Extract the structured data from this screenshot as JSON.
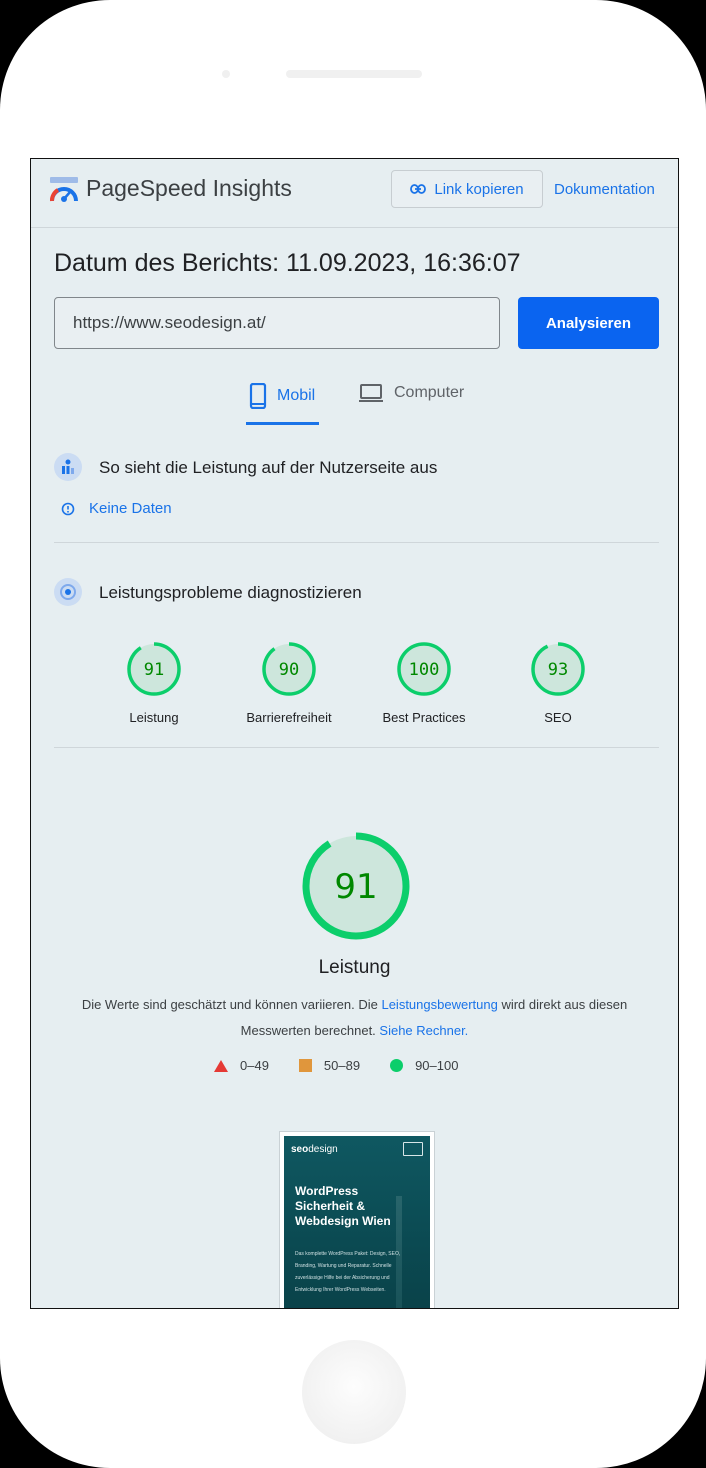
{
  "app": {
    "title": "PageSpeed Insights",
    "copy_link_label": "Link kopieren",
    "docs_label": "Dokumentation"
  },
  "report": {
    "date_label": "Datum des Berichts: 11.09.2023, 16:36:07",
    "url_value": "https://www.seodesign.at/",
    "analyze_label": "Analysieren"
  },
  "tabs": [
    {
      "label": "Mobil",
      "active": true,
      "icon": "phone-icon"
    },
    {
      "label": "Computer",
      "active": false,
      "icon": "laptop-icon"
    }
  ],
  "field_section": {
    "title": "So sieht die Leistung auf der Nutzerseite aus",
    "no_data_label": "Keine Daten"
  },
  "lab_section": {
    "title": "Leistungsprobleme diagnostizieren",
    "scores": [
      {
        "value": 91,
        "label": "Leistung"
      },
      {
        "value": 90,
        "label": "Barrierefreiheit"
      },
      {
        "value": 100,
        "label": "Best Practices"
      },
      {
        "value": 93,
        "label": "SEO"
      }
    ]
  },
  "performance": {
    "score": 91,
    "label": "Leistung",
    "desc_part1": "Die Werte sind geschätzt und können variieren. Die ",
    "desc_link1": "Leistungsbewertung",
    "desc_part2": " wird direkt aus diesen Messwerten berechnet. ",
    "desc_link2": "Siehe Rechner.",
    "legend": [
      {
        "range": "0–49",
        "shape": "triangle",
        "color": "#e53935"
      },
      {
        "range": "50–89",
        "shape": "square",
        "color": "#e0963c"
      },
      {
        "range": "90–100",
        "shape": "circle",
        "color": "#0cce6b"
      }
    ]
  },
  "thumbnail": {
    "logo_bold": "seo",
    "logo_rest": "design",
    "headline": "WordPress Sicherheit & Webdesign Wien",
    "text": "Das komplette WordPress Paket: Design, SEO, Branding, Wartung und Reparatur. Schnelle zuverlässige Hilfe bei der Absicherung und Entwicklung Ihrer WordPress Webseiten."
  },
  "colors": {
    "accent": "#1a73e8",
    "primary_button": "#0a64f0",
    "pass_green": "#0cce6b",
    "score_text_green": "#008800",
    "background": "#e6eef1"
  }
}
